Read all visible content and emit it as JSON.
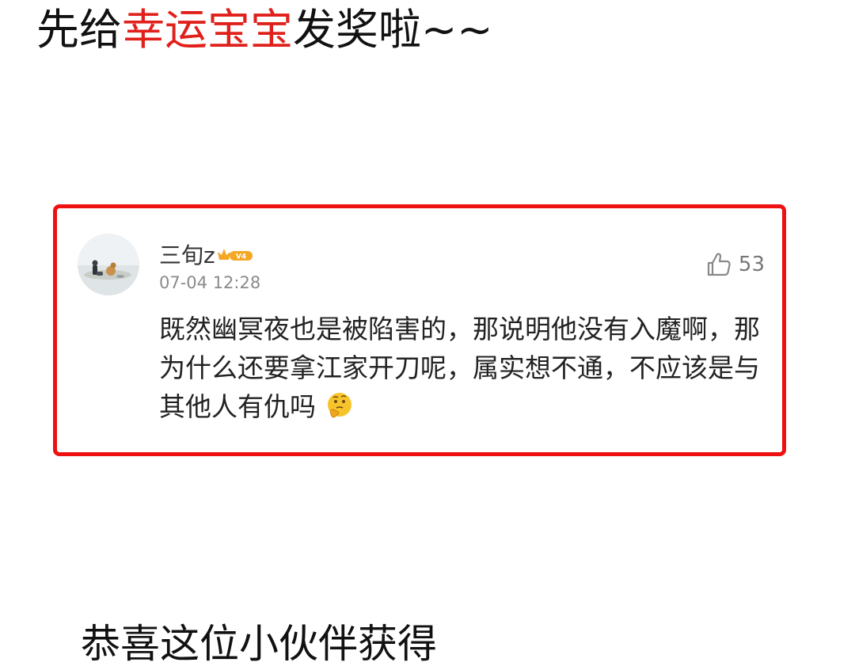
{
  "headline": {
    "part1": "先给",
    "highlight": "幸运宝宝",
    "part2": "发奖啦~~"
  },
  "comment_card": {
    "username": "三旬z",
    "vip_badge_text": "V4",
    "timestamp": "07-04 12:28",
    "like_count": "53",
    "body": "既然幽冥夜也是被陷害的，那说明他没有入魔啊，那为什么还要拿江家开刀呢，属实想不通，不应该是与其他人有仇吗",
    "avatar_icon": "user-avatar-photo",
    "like_icon": "thumbs-up-icon",
    "emoji_icon": "thinking-face-emoji"
  },
  "congrats_text": "恭喜这位小伙伴获得",
  "colors": {
    "highlight_red": "#e0201b",
    "frame_red": "#ee1111",
    "timestamp_gray": "#8a8a8a",
    "badge_orange": "#f5a623"
  }
}
